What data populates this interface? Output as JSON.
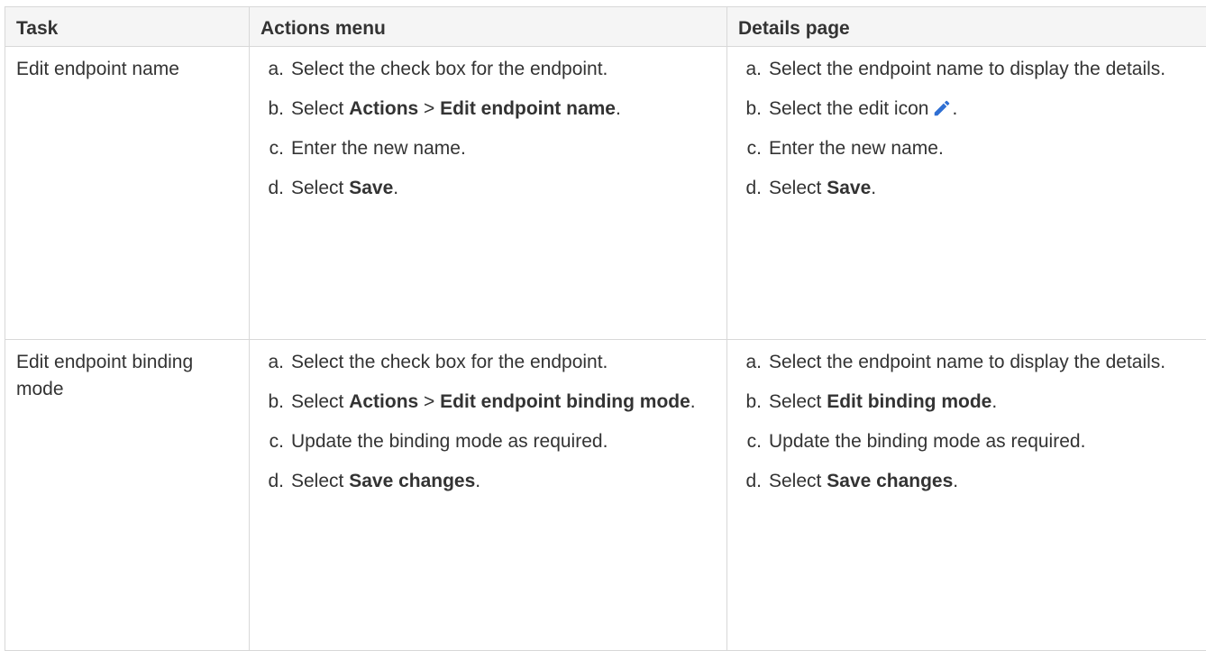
{
  "columns": {
    "task": "Task",
    "actions_menu": "Actions menu",
    "details_page": "Details page"
  },
  "rows": [
    {
      "task": "Edit endpoint name",
      "actions_menu": {
        "a": {
          "marker": "a.",
          "text1": "Select the check box for the endpoint."
        },
        "b": {
          "marker": "b.",
          "pre": "Select ",
          "bold1": "Actions",
          "sep": " > ",
          "bold2": "Edit endpoint name",
          "post": "."
        },
        "c": {
          "marker": "c.",
          "text1": "Enter the new name."
        },
        "d": {
          "marker": "d.",
          "pre": "Select ",
          "bold1": "Save",
          "post": "."
        }
      },
      "details_page": {
        "a": {
          "marker": "a.",
          "text1": "Select the endpoint name to display the details."
        },
        "b": {
          "marker": "b.",
          "pre": "Select the edit icon",
          "icon": "pencil-edit-icon",
          "post": "."
        },
        "c": {
          "marker": "c.",
          "text1": "Enter the new name."
        },
        "d": {
          "marker": "d.",
          "pre": "Select ",
          "bold1": "Save",
          "post": "."
        }
      }
    },
    {
      "task": "Edit endpoint binding mode",
      "actions_menu": {
        "a": {
          "marker": "a.",
          "text1": "Select the check box for the endpoint."
        },
        "b": {
          "marker": "b.",
          "pre": "Select ",
          "bold1": "Actions",
          "sep": " > ",
          "bold2": "Edit endpoint binding mode",
          "post": "."
        },
        "c": {
          "marker": "c.",
          "text1": "Update the binding mode as required."
        },
        "d": {
          "marker": "d.",
          "pre": "Select ",
          "bold1": "Save changes",
          "post": "."
        }
      },
      "details_page": {
        "a": {
          "marker": "a.",
          "text1": "Select the endpoint name to display the details."
        },
        "b": {
          "marker": "b.",
          "pre": "Select ",
          "bold1": "Edit binding mode",
          "post": "."
        },
        "c": {
          "marker": "c.",
          "text1": "Update the binding mode as required."
        },
        "d": {
          "marker": "d.",
          "pre": "Select ",
          "bold1": "Save changes",
          "post": "."
        }
      }
    }
  ],
  "colors": {
    "icon_blue": "#2f6fd3",
    "header_bg": "#f5f5f5",
    "border": "#d8d8d8",
    "text": "#333333"
  }
}
